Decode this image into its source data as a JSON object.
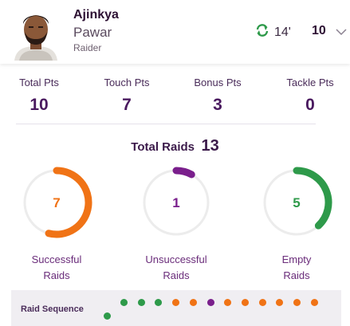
{
  "player": {
    "first_name": "Ajinkya",
    "last_name": "Pawar",
    "role": "Raider",
    "time": "14'",
    "score": "10"
  },
  "icons": {
    "refresh": "refresh-icon",
    "chevron": "chevron-down-icon"
  },
  "stats": [
    {
      "label": "Total Pts",
      "value": "10"
    },
    {
      "label": "Touch Pts",
      "value": "7"
    },
    {
      "label": "Bonus Pts",
      "value": "3"
    },
    {
      "label": "Tackle Pts",
      "value": "0"
    }
  ],
  "total_raids": {
    "label": "Total Raids",
    "value": "13"
  },
  "raid_types": [
    {
      "label_line1": "Successful",
      "label_line2": "Raids",
      "value": "7",
      "fraction": 0.54,
      "color": "#f07316"
    },
    {
      "label_line1": "Unsuccessful",
      "label_line2": "Raids",
      "value": "1",
      "fraction": 0.08,
      "color": "#7a1f8c"
    },
    {
      "label_line1": "Empty",
      "label_line2": "Raids",
      "value": "5",
      "fraction": 0.38,
      "color": "#2e9a4a"
    }
  ],
  "sequence": {
    "label": "Raid Sequence",
    "raids": [
      "empty",
      "empty",
      "empty",
      "empty",
      "successful",
      "successful",
      "unsuccessful",
      "successful",
      "successful",
      "successful",
      "successful",
      "successful",
      "successful"
    ]
  },
  "colors": {
    "successful": "#f07316",
    "unsuccessful": "#7a1f8c",
    "empty": "#2e9a4a",
    "accent": "#4a1a5f",
    "ring_track": "#ececec"
  }
}
